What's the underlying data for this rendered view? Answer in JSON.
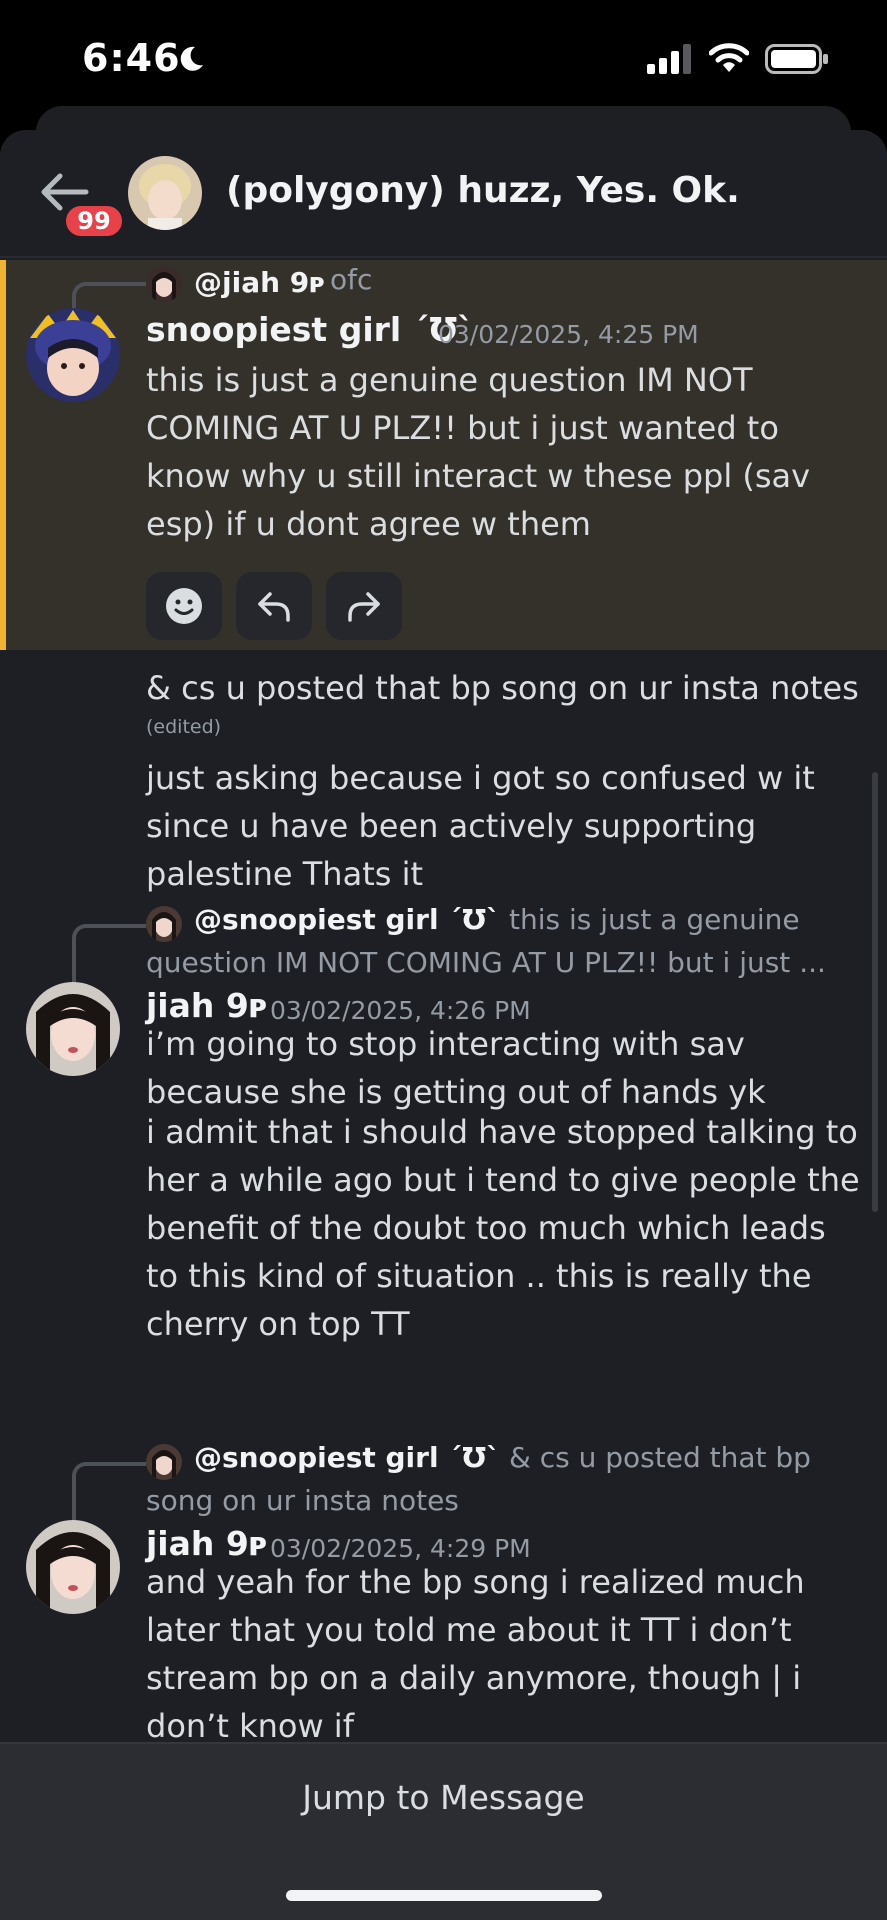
{
  "status_bar": {
    "time": "6:46"
  },
  "header": {
    "unread_badge": "99",
    "title": "(polygony) huzz, Yes. Ok."
  },
  "messages": [
    {
      "reply": {
        "name": "@jiah 9ᴩ",
        "text": "ofc"
      },
      "author": "snoopiest girl ´Ʊ`",
      "timestamp": "03/02/2025, 4:25 PM",
      "lines": [
        "this is just a genuine question IM NOT COMING AT U PLZ!! but i just wanted to know why u still interact w these ppl (sav esp) if u dont agree w them"
      ]
    },
    {
      "text": "& cs u posted that bp song on ur insta notes",
      "edited": "(edited)"
    },
    {
      "text": "just asking because i got so confused w it since u have been actively supporting palestine Thats it"
    },
    {
      "reply": {
        "name": "@snoopiest girl ´Ʊ`",
        "text": "this is just a genuine question IM NOT COMING AT U PLZ!! but i just ..."
      },
      "author": "jiah 9ᴩ",
      "timestamp": "03/02/2025, 4:26 PM",
      "lines": [
        "i’m going to stop interacting with sav because she is getting out of hands yk",
        "i admit that i should have stopped talking to her a while ago but i tend to give people the benefit of the doubt too much which leads to this kind of situation .. this is really the cherry on top TT"
      ]
    },
    {
      "reply": {
        "name": "@snoopiest girl ´Ʊ`",
        "text": "& cs u posted that bp song on ur insta notes"
      },
      "author": "jiah 9ᴩ",
      "timestamp": "03/02/2025, 4:29 PM",
      "lines": [
        "and yeah for the bp song i realized much later that you told me about it TT i don’t stream bp on a daily anymore, though | i don’t know if"
      ]
    }
  ],
  "actions": {
    "reaction_icon": "smile-icon",
    "reply_icon": "reply-icon",
    "forward_icon": "forward-icon"
  },
  "footer": {
    "jump_label": "Jump to Message"
  },
  "colors": {
    "background": "#1e1f24",
    "highlight": "#34302a",
    "highlight_bar": "#f0b232",
    "badge": "#e8414a",
    "footer": "#2b2d33"
  }
}
